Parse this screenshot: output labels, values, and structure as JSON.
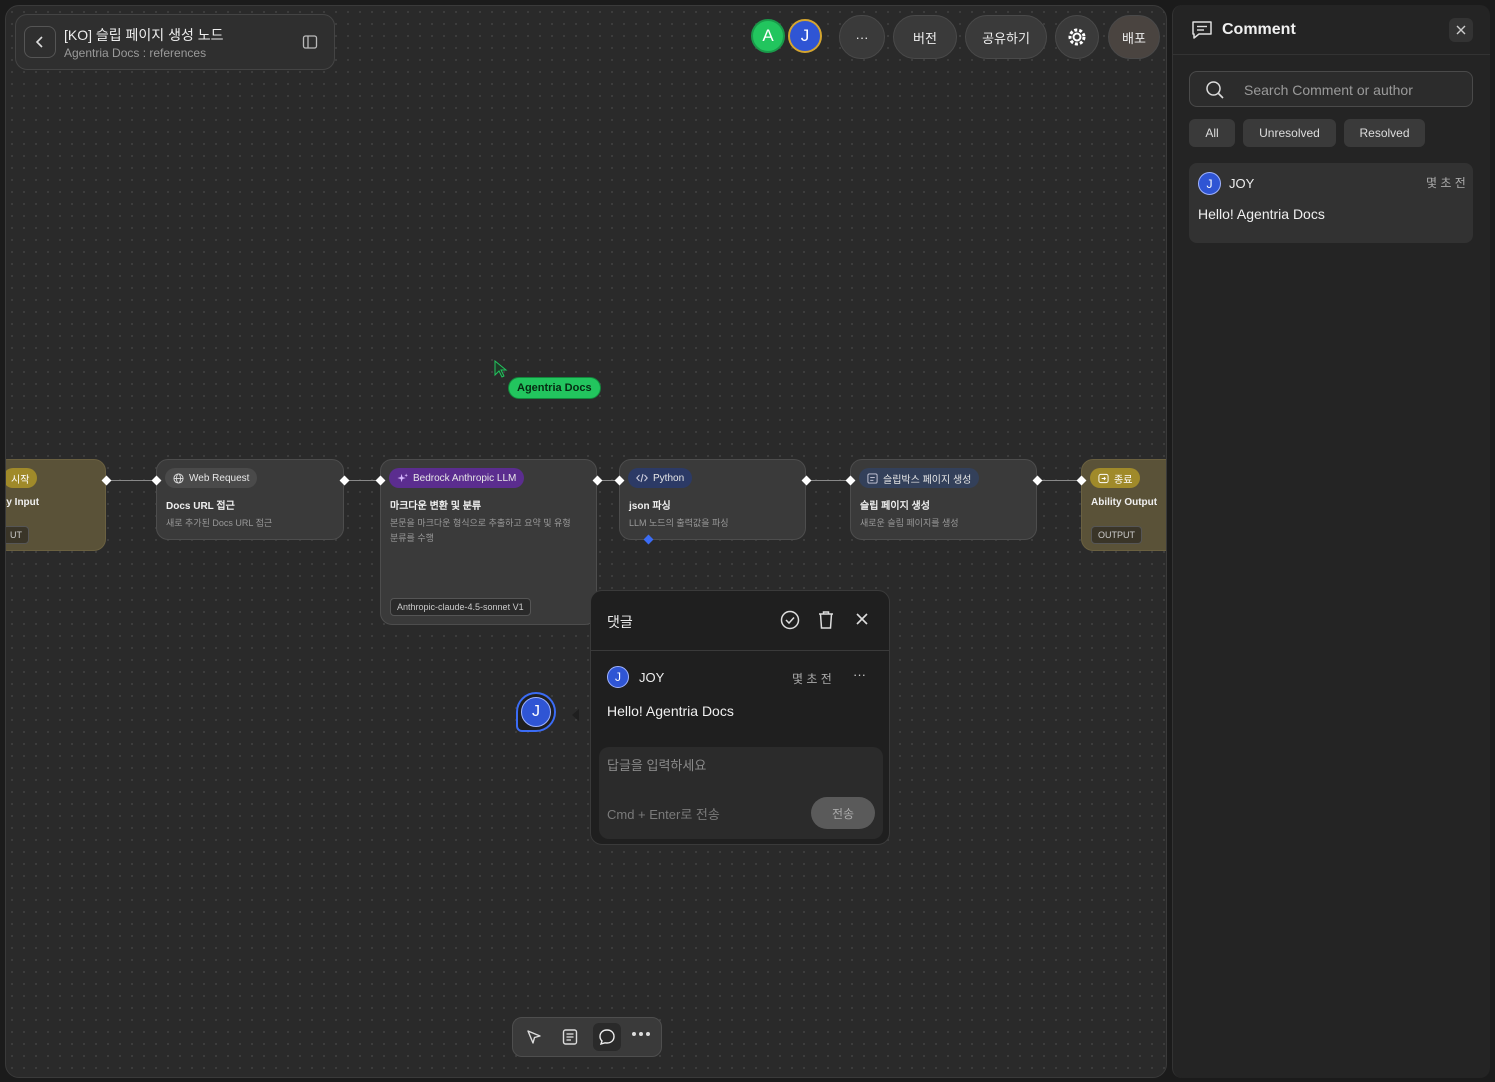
{
  "header": {
    "title": "[KO] 슬립 페이지 생성 노드",
    "subtitle": "Agentria Docs : references",
    "avatars": [
      {
        "letter": "A",
        "color": "#22c55e"
      },
      {
        "letter": "J",
        "color": "#2f55d4"
      }
    ],
    "more_label": "···",
    "version_label": "버전",
    "share_label": "공유하기",
    "deploy_label": "배포"
  },
  "cursor": {
    "label": "Agentria Docs"
  },
  "nodes": [
    {
      "tag": "시작",
      "title": "ty Input",
      "chip": "UT"
    },
    {
      "tag": "Web Request",
      "title": "Docs URL 접근",
      "desc": "새로 추가된 Docs URL 접근"
    },
    {
      "tag": "Bedrock Anthropic LLM",
      "title": "마크다운 변환 및 분류",
      "desc1": "본문을 마크다운 형식으로 추출하고 요약 및 유형",
      "desc2": "분류를 수행",
      "chip": "Anthropic-claude-4.5-sonnet V1"
    },
    {
      "tag": "Python",
      "title": "json 파싱",
      "desc": "LLM 노드의 출력값을 파싱"
    },
    {
      "tag": "슬립박스 페이지 생성",
      "title": "슬립 페이지 생성",
      "desc": "새로운 슬립 페이지를 생성"
    },
    {
      "tag": "종료",
      "title": "Ability Output",
      "chip": "OUTPUT"
    }
  ],
  "comment_popup": {
    "title": "댓글",
    "author": "JOY",
    "author_initial": "J",
    "time": "몇 초 전",
    "more": "···",
    "text": "Hello! Agentria Docs",
    "reply_placeholder": "답글을 입력하세요",
    "hint": "Cmd + Enter로 전송",
    "send_label": "전송"
  },
  "pin": {
    "initial": "J"
  },
  "sidebar": {
    "title": "Comment",
    "search_placeholder": "Search Comment or author",
    "filters": [
      "All",
      "Unresolved",
      "Resolved"
    ],
    "comments": [
      {
        "initial": "J",
        "author": "JOY",
        "time": "몇 초 전",
        "text": "Hello! Agentria Docs"
      }
    ]
  }
}
